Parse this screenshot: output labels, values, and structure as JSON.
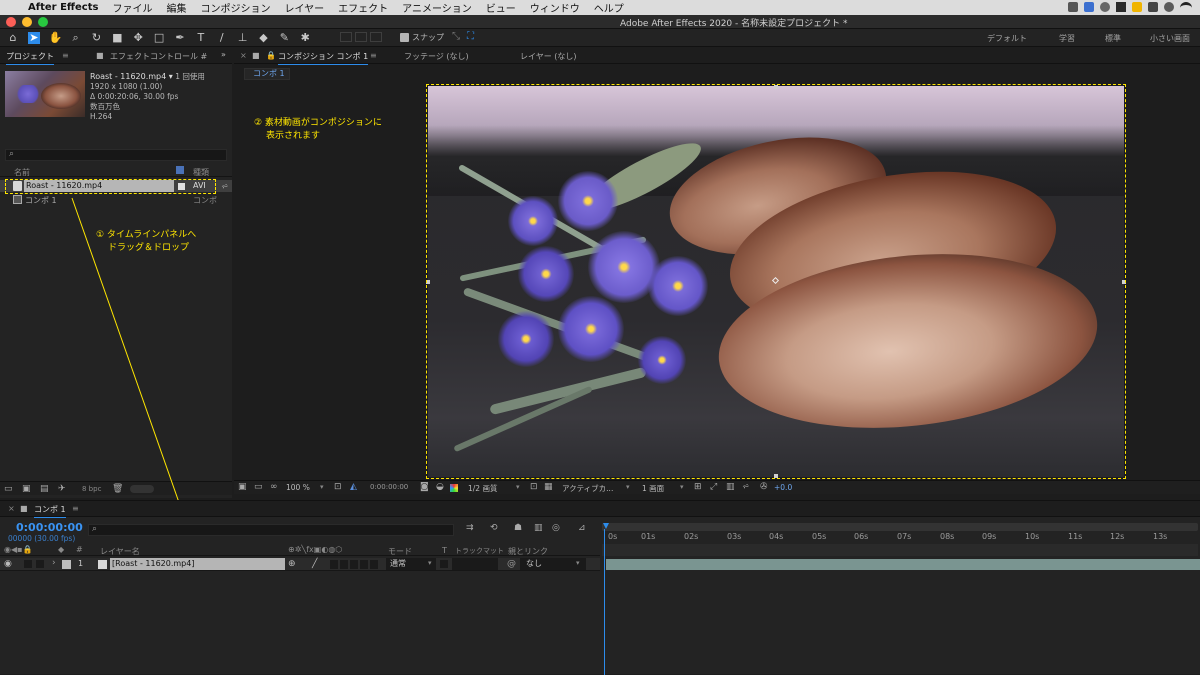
{
  "menu": {
    "apple": "",
    "app": "After Effects",
    "items": [
      "ファイル",
      "編集",
      "コンポジション",
      "レイヤー",
      "エフェクト",
      "アニメーション",
      "ビュー",
      "ウィンドウ",
      "ヘルプ"
    ]
  },
  "window_title": "Adobe After Effects 2020 - 名称未設定プロジェクト *",
  "toolbar": {
    "snap_label": "スナップ",
    "workspaces": [
      "デフォルト",
      "学習",
      "標準",
      "小さい画面"
    ]
  },
  "project": {
    "tab_project": "プロジェクト",
    "tab_effects": "エフェクトコントロール #",
    "thumb": {
      "name": "Roast - 11620.mp4 ▾",
      "used": "1 回使用",
      "res": "1920 x 1080 (1.00)",
      "dur": "Δ 0:00:20:06, 30.00 fps",
      "color": "数百万色",
      "codec": "H.264"
    },
    "search_icon": "⌕",
    "col_name": "名前",
    "col_type": "種類",
    "items": [
      {
        "name": "Roast - 11620.mp4",
        "type": "AVI"
      },
      {
        "name": "コンポ 1",
        "type": "コンポ"
      }
    ],
    "bpc": "8 bpc"
  },
  "comp": {
    "tab_comp": "コンポジション コンポ 1",
    "tab_footage": "フッテージ (なし)",
    "tab_layer": "レイヤー (なし)",
    "subtab": "コンポ 1",
    "zoom": "100 %",
    "time": "0:00:00:00",
    "quality": "1/2 画質",
    "camera": "アクティブカ...",
    "views": "1 画面",
    "exposure": "+0.0"
  },
  "annotations": {
    "a1_line1": "① タイムラインパネルへ",
    "a1_line2": "ドラッグ＆ドロップ",
    "a2_line1": "② 素材動画がコンポジションに",
    "a2_line2": "表示されます"
  },
  "timeline": {
    "tab": "コンポ 1",
    "timecode": "0:00:00:00",
    "frames": "00000 (30.00 fps)",
    "col_layer": "レイヤー名",
    "col_mode": "モード",
    "col_t": "T",
    "col_trackmatte": "トラックマット",
    "col_parent": "親とリンク",
    "layer": {
      "index": "1",
      "name": "[Roast - 11620.mp4]",
      "mode": "通常",
      "parent": "なし"
    },
    "ticks": [
      "0s",
      "01s",
      "02s",
      "03s",
      "04s",
      "05s",
      "06s",
      "07s",
      "08s",
      "09s",
      "10s",
      "11s",
      "12s",
      "13s"
    ]
  },
  "colors": {
    "annotation": "#ffe600",
    "accent": "#2d8ceb",
    "layer_bar": "#7a9591"
  }
}
